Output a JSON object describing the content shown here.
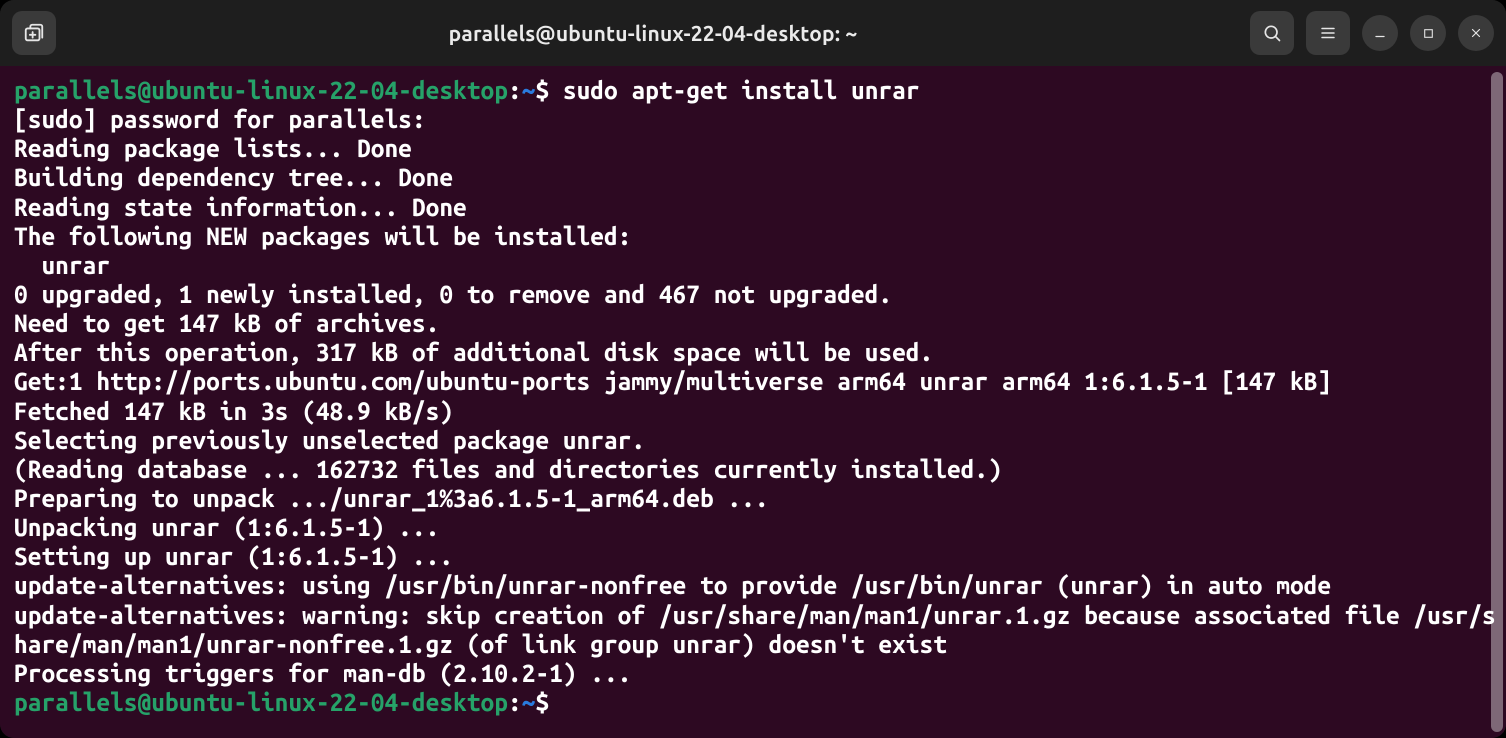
{
  "window": {
    "title": "parallels@ubuntu-linux-22-04-desktop: ~"
  },
  "prompts": [
    {
      "user_host": "parallels@ubuntu-linux-22-04-desktop",
      "sep": ":",
      "path": "~",
      "end": "$",
      "command": "sudo apt-get install unrar"
    },
    {
      "user_host": "parallels@ubuntu-linux-22-04-desktop",
      "sep": ":",
      "path": "~",
      "end": "$",
      "command": ""
    }
  ],
  "output_lines": [
    "[sudo] password for parallels:",
    "Reading package lists... Done",
    "Building dependency tree... Done",
    "Reading state information... Done",
    "The following NEW packages will be installed:",
    "  unrar",
    "0 upgraded, 1 newly installed, 0 to remove and 467 not upgraded.",
    "Need to get 147 kB of archives.",
    "After this operation, 317 kB of additional disk space will be used.",
    "Get:1 http://ports.ubuntu.com/ubuntu-ports jammy/multiverse arm64 unrar arm64 1:6.1.5-1 [147 kB]",
    "Fetched 147 kB in 3s (48.9 kB/s)",
    "Selecting previously unselected package unrar.",
    "(Reading database ... 162732 files and directories currently installed.)",
    "Preparing to unpack .../unrar_1%3a6.1.5-1_arm64.deb ...",
    "Unpacking unrar (1:6.1.5-1) ...",
    "Setting up unrar (1:6.1.5-1) ...",
    "update-alternatives: using /usr/bin/unrar-nonfree to provide /usr/bin/unrar (unrar) in auto mode",
    "update-alternatives: warning: skip creation of /usr/share/man/man1/unrar.1.gz because associated file /usr/share/man/man1/unrar-nonfree.1.gz (of link group unrar) doesn't exist",
    "Processing triggers for man-db (2.10.2-1) ..."
  ]
}
